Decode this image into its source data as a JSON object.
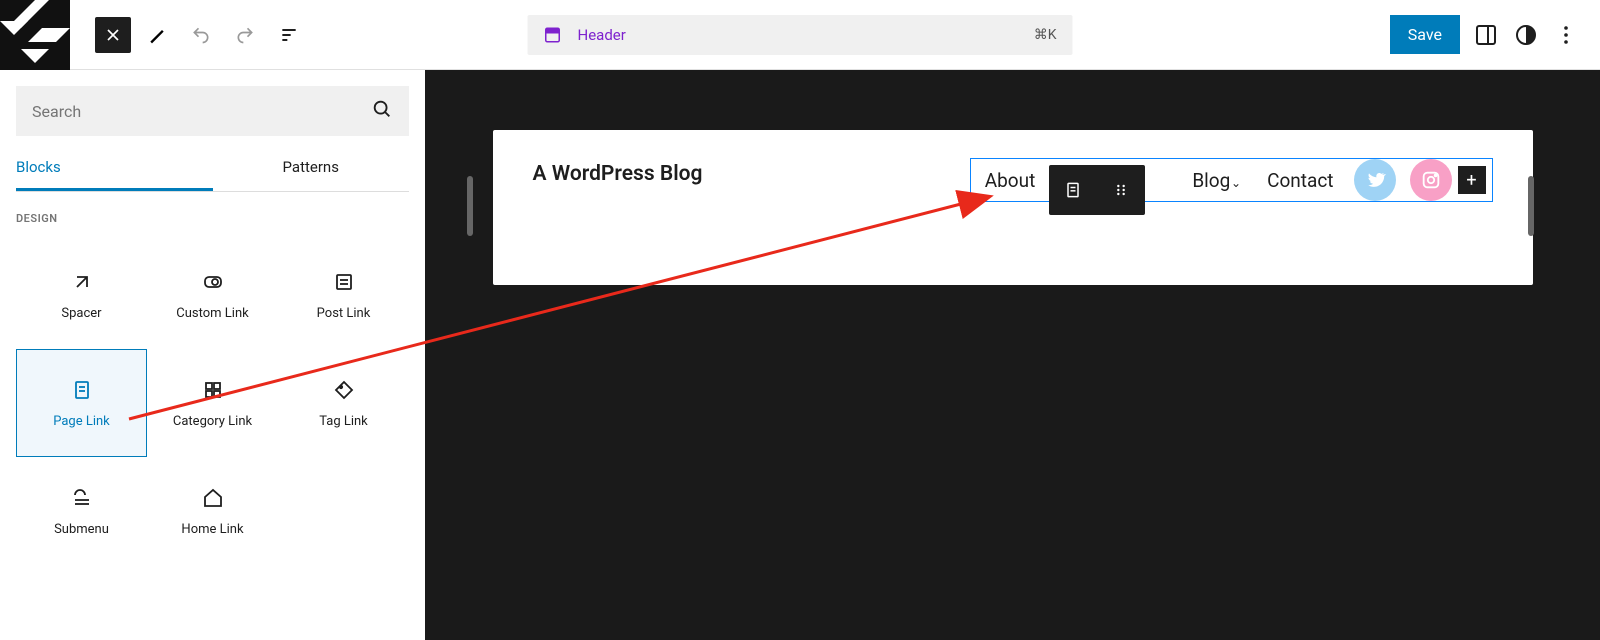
{
  "top": {
    "template_label": "Header",
    "shortcut": "⌘K",
    "save_label": "Save"
  },
  "sidebar": {
    "search_placeholder": "Search",
    "tabs": {
      "blocks": "Blocks",
      "patterns": "Patterns"
    },
    "section": "DESIGN",
    "blocks": {
      "spacer": "Spacer",
      "custom_link": "Custom Link",
      "post_link": "Post Link",
      "page_link": "Page Link",
      "category_link": "Category Link",
      "tag_link": "Tag Link",
      "submenu": "Submenu",
      "home_link": "Home Link"
    }
  },
  "canvas": {
    "site_title": "A WordPress Blog",
    "nav": {
      "about": "About",
      "blog": "Blog",
      "contact": "Contact"
    }
  }
}
